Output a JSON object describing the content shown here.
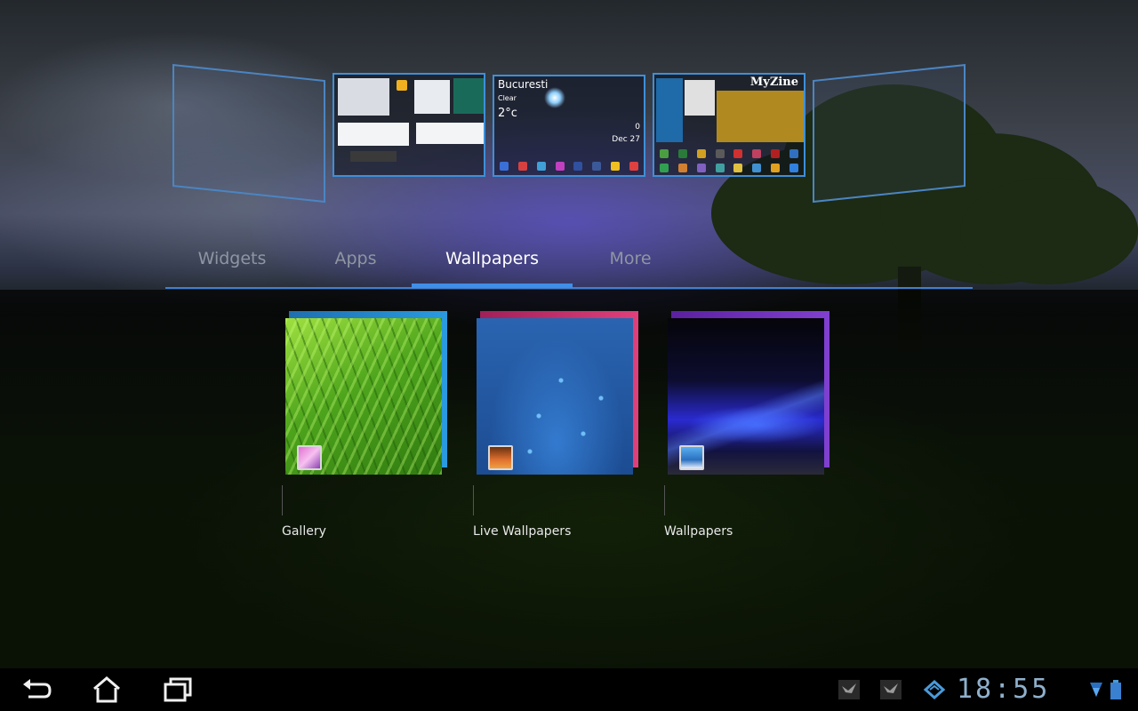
{
  "workspaces": {
    "weather_widget": {
      "city": "Bucuresti",
      "condition": "Clear",
      "temperature": "2°c",
      "mail_count": "0",
      "date": "Dec 27"
    },
    "magazine_widget": {
      "title": "MyZine"
    }
  },
  "tabs": {
    "widgets": "Widgets",
    "apps": "Apps",
    "wallpapers": "Wallpapers",
    "more": "More",
    "active": "wallpapers"
  },
  "wallpaper_sources": [
    {
      "label": "Gallery",
      "icon": "gallery-icon"
    },
    {
      "label": "Live Wallpapers",
      "icon": "live-wallpaper-icon"
    },
    {
      "label": "Wallpapers",
      "icon": "wallpaper-icon"
    }
  ],
  "system_bar": {
    "clock": "18:55",
    "nav_icons": [
      "back-icon",
      "home-icon",
      "recent-apps-icon"
    ],
    "notification_icons": [
      "notification-bird-icon",
      "notification-bird-icon",
      "sync-icon"
    ],
    "status_icons": [
      "wifi-icon",
      "battery-icon"
    ],
    "accent_color": "#3f8fe8"
  }
}
